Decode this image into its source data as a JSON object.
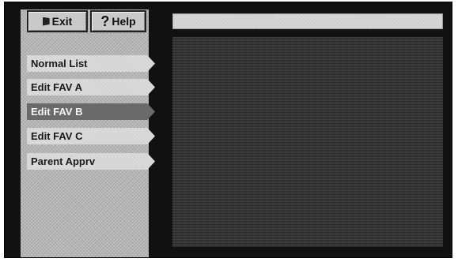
{
  "toolbar": {
    "exit_label": "Exit",
    "help_label": "Help",
    "exit_icon": "exit-icon",
    "help_icon": "question-mark-icon",
    "help_glyph": "?"
  },
  "menu": {
    "items": [
      {
        "label": "Normal List",
        "selected": false
      },
      {
        "label": "Edit FAV A",
        "selected": false
      },
      {
        "label": "Edit FAV B",
        "selected": true
      },
      {
        "label": "Edit FAV C",
        "selected": false
      },
      {
        "label": "Parent Apprv",
        "selected": false
      }
    ]
  },
  "main": {
    "header_text": ""
  },
  "colors": {
    "frame": "#111111",
    "sidebar": "#b7b7b7",
    "selected": "#6a6a6a",
    "content": "#3b3b3b"
  }
}
